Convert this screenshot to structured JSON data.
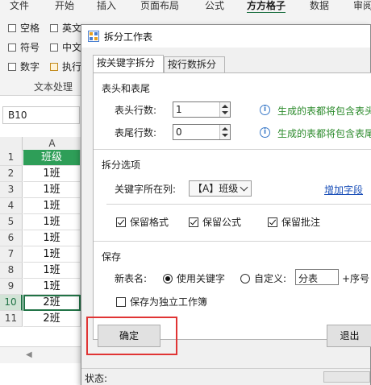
{
  "ribbon": {
    "tabs": [
      "文件",
      "开始",
      "插入",
      "页面布局",
      "公式",
      "方方格子",
      "数据",
      "审阅"
    ],
    "checks_col1": [
      "空格",
      "符号",
      "数字"
    ],
    "checks_col2": [
      "英文",
      "中文",
      "执行"
    ],
    "group_label": "文本处理"
  },
  "formula_bar": {
    "name_box": "B10"
  },
  "sheet": {
    "column_header": "A",
    "rows": [
      {
        "num": "1",
        "value": "班级"
      },
      {
        "num": "2",
        "value": "1班"
      },
      {
        "num": "3",
        "value": "1班"
      },
      {
        "num": "4",
        "value": "1班"
      },
      {
        "num": "5",
        "value": "1班"
      },
      {
        "num": "6",
        "value": "1班"
      },
      {
        "num": "7",
        "value": "1班"
      },
      {
        "num": "8",
        "value": "1班"
      },
      {
        "num": "9",
        "value": "1班"
      },
      {
        "num": "10",
        "value": "2班"
      },
      {
        "num": "11",
        "value": "2班"
      }
    ]
  },
  "dialog": {
    "title": "拆分工作表",
    "tabs": [
      "按关键字拆分",
      "按行数拆分"
    ],
    "header_footer": {
      "section_title": "表头和表尾",
      "header_rows_label": "表头行数:",
      "header_rows_value": "1",
      "footer_rows_label": "表尾行数:",
      "footer_rows_value": "0",
      "header_hint": "生成的表都将包含表头",
      "footer_hint": "生成的表都将包含表尾"
    },
    "split_options": {
      "section_title": "拆分选项",
      "key_column_label": "关键字所在列:",
      "key_column_value": "【A】班级",
      "add_field_link": "增加字段",
      "keep_format": "保留格式",
      "keep_formula": "保留公式",
      "keep_comment": "保留批注"
    },
    "save": {
      "section_title": "保存",
      "new_name_label": "新表名:",
      "use_keyword": "使用关键字",
      "custom": "自定义:",
      "custom_value": "分表",
      "suffix": "+序号",
      "save_as_workbook": "保存为独立工作簿"
    },
    "ok_button": "确定",
    "cancel_button": "退出",
    "status_label": "状态:"
  },
  "colors": {
    "accent": "#217346",
    "header_fill": "#2e9e58",
    "highlight": "#e03434"
  }
}
